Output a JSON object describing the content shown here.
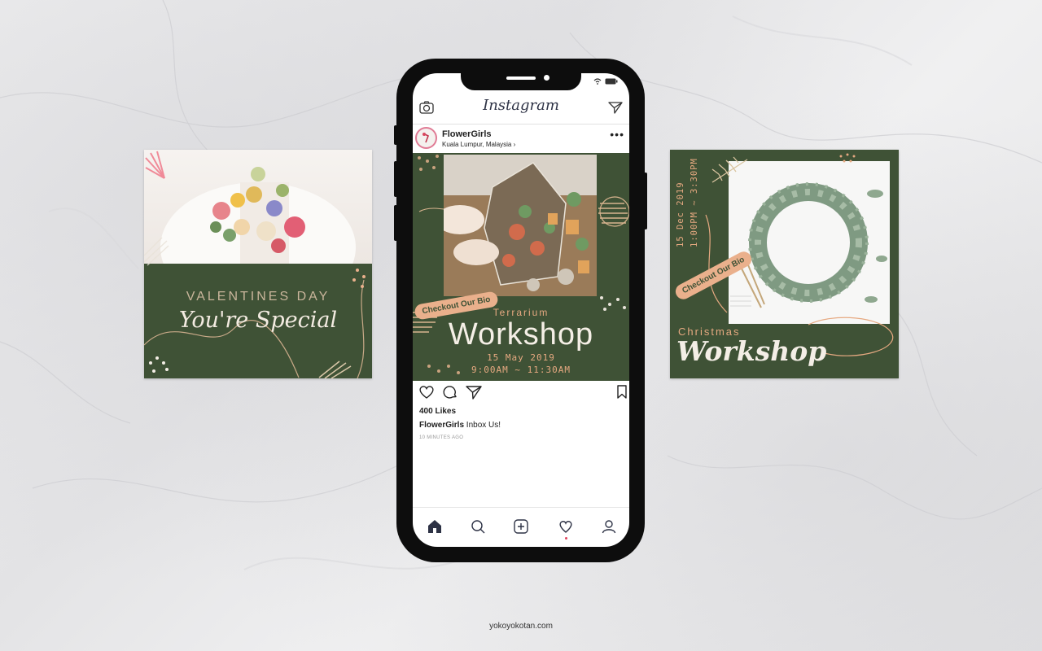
{
  "left_card": {
    "title": "VALENTINES DAY",
    "subtitle": "You're Special"
  },
  "right_card": {
    "date": "15 Dec 2019",
    "time": "1:00PM ~ 3:30PM",
    "badge": "Checkout Our Bio",
    "label": "Christmas",
    "title": "Workshop"
  },
  "instagram": {
    "app_title": "Instagram",
    "post": {
      "username": "FlowerGirls",
      "location": "Kuala Lumpur, Malaysia",
      "location_chevron": "›",
      "more": "•••",
      "image": {
        "badge": "Checkout Our Bio",
        "subtitle": "Terrarium",
        "title": "Workshop",
        "date": "15 May 2019",
        "time": "9:00AM ~ 11:30AM"
      },
      "likes": "400 Likes",
      "caption_user": "FlowerGirls",
      "caption_text": "Inbox Us!",
      "time_ago": "10 MINUTES AGO"
    },
    "tabs": [
      "home-icon",
      "search-icon",
      "add-post-icon",
      "activity-heart-icon",
      "profile-icon"
    ]
  },
  "footer": "yokoyokotan.com",
  "colors": {
    "forest_green": "#3f5236",
    "peach": "#eab08c",
    "cream": "#f4eee6"
  }
}
